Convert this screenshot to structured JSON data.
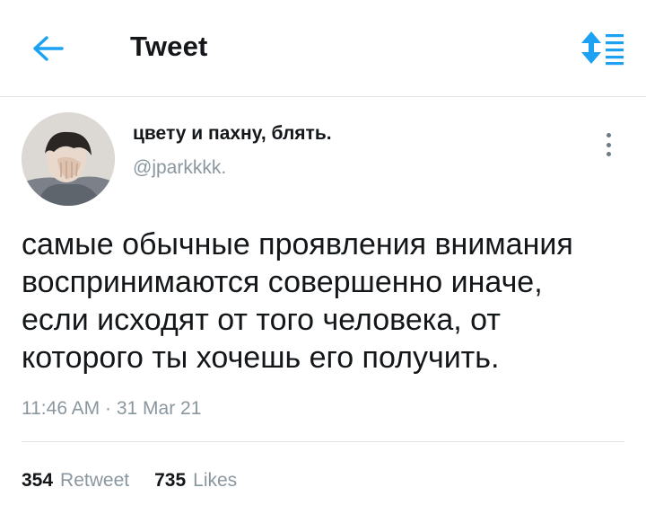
{
  "header": {
    "title": "Tweet",
    "back_icon": "arrow-left-icon",
    "sort_icon": "sort-icon",
    "accent_color": "#1da1f2"
  },
  "tweet": {
    "author_name": "цвету и пахну, блять.",
    "author_handle": "@jparkkkk.",
    "text_lines": [
      "самые обычные проявления внимания",
      "воспринимаются совершенно иначе,",
      "если исходят от того человека, от",
      "которого ты хочешь его получить."
    ],
    "timestamp": "11:46 AM · 31 Mar 21",
    "retweets": {
      "count": "354",
      "label": "Retweet"
    },
    "likes": {
      "count": "735",
      "label": "Likes"
    },
    "more_icon": "more-vertical-icon"
  }
}
